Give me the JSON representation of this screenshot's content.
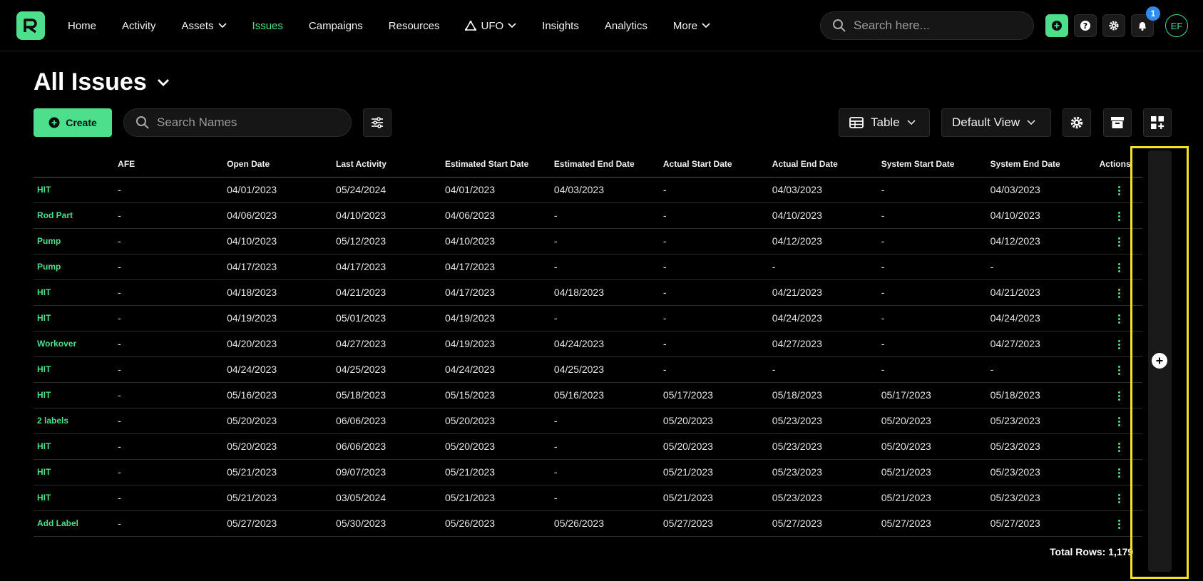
{
  "nav": {
    "items": [
      {
        "label": "Home",
        "name": "nav-home",
        "active": false,
        "dropdown": false,
        "icon": ""
      },
      {
        "label": "Activity",
        "name": "nav-activity",
        "active": false,
        "dropdown": false,
        "icon": ""
      },
      {
        "label": "Assets",
        "name": "nav-assets",
        "active": false,
        "dropdown": true,
        "icon": ""
      },
      {
        "label": "Issues",
        "name": "nav-issues",
        "active": true,
        "dropdown": false,
        "icon": ""
      },
      {
        "label": "Campaigns",
        "name": "nav-campaigns",
        "active": false,
        "dropdown": false,
        "icon": ""
      },
      {
        "label": "Resources",
        "name": "nav-resources",
        "active": false,
        "dropdown": false,
        "icon": ""
      },
      {
        "label": "UFO",
        "name": "nav-ufo",
        "active": false,
        "dropdown": true,
        "icon": "triangle-nodes-icon"
      },
      {
        "label": "Insights",
        "name": "nav-insights",
        "active": false,
        "dropdown": false,
        "icon": ""
      },
      {
        "label": "Analytics",
        "name": "nav-analytics",
        "active": false,
        "dropdown": false,
        "icon": ""
      },
      {
        "label": "More",
        "name": "nav-more",
        "active": false,
        "dropdown": true,
        "icon": ""
      }
    ],
    "search_placeholder": "Search here...",
    "notification_count": "1",
    "avatar_initials": "EF"
  },
  "page": {
    "title": "All Issues",
    "create_label": "Create",
    "search_placeholder": "Search Names",
    "view_mode": "Table",
    "saved_view": "Default View"
  },
  "colors": {
    "accent": "#4ddf8b",
    "highlight": "#f5e12a",
    "badge": "#2f8cf0"
  },
  "table": {
    "columns": [
      "",
      "AFE",
      "Open Date",
      "Last Activity",
      "Estimated Start Date",
      "Estimated End Date",
      "Actual Start Date",
      "Actual End Date",
      "System Start Date",
      "System End Date",
      "Actions"
    ],
    "rows": [
      [
        "HIT",
        "-",
        "04/01/2023",
        "05/24/2024",
        "04/01/2023",
        "04/03/2023",
        "-",
        "04/03/2023",
        "-",
        "04/03/2023"
      ],
      [
        "Rod Part",
        "-",
        "04/06/2023",
        "04/10/2023",
        "04/06/2023",
        "-",
        "-",
        "04/10/2023",
        "-",
        "04/10/2023"
      ],
      [
        "Pump",
        "-",
        "04/10/2023",
        "05/12/2023",
        "04/10/2023",
        "-",
        "-",
        "04/12/2023",
        "-",
        "04/12/2023"
      ],
      [
        "Pump",
        "-",
        "04/17/2023",
        "04/17/2023",
        "04/17/2023",
        "-",
        "-",
        "-",
        "-",
        "-"
      ],
      [
        "HIT",
        "-",
        "04/18/2023",
        "04/21/2023",
        "04/17/2023",
        "04/18/2023",
        "-",
        "04/21/2023",
        "-",
        "04/21/2023"
      ],
      [
        "HIT",
        "-",
        "04/19/2023",
        "05/01/2023",
        "04/19/2023",
        "-",
        "-",
        "04/24/2023",
        "-",
        "04/24/2023"
      ],
      [
        "Workover",
        "-",
        "04/20/2023",
        "04/27/2023",
        "04/19/2023",
        "04/24/2023",
        "-",
        "04/27/2023",
        "-",
        "04/27/2023"
      ],
      [
        "HIT",
        "-",
        "04/24/2023",
        "04/25/2023",
        "04/24/2023",
        "04/25/2023",
        "-",
        "-",
        "-",
        "-"
      ],
      [
        "HIT",
        "-",
        "05/16/2023",
        "05/18/2023",
        "05/15/2023",
        "05/16/2023",
        "05/17/2023",
        "05/18/2023",
        "05/17/2023",
        "05/18/2023"
      ],
      [
        "2 labels",
        "-",
        "05/20/2023",
        "06/06/2023",
        "05/20/2023",
        "-",
        "05/20/2023",
        "05/23/2023",
        "05/20/2023",
        "05/23/2023"
      ],
      [
        "HIT",
        "-",
        "05/20/2023",
        "06/06/2023",
        "05/20/2023",
        "-",
        "05/20/2023",
        "05/23/2023",
        "05/20/2023",
        "05/23/2023"
      ],
      [
        "HIT",
        "-",
        "05/21/2023",
        "09/07/2023",
        "05/21/2023",
        "-",
        "05/21/2023",
        "05/23/2023",
        "05/21/2023",
        "05/23/2023"
      ],
      [
        "HIT",
        "-",
        "05/21/2023",
        "03/05/2024",
        "05/21/2023",
        "-",
        "05/21/2023",
        "05/23/2023",
        "05/21/2023",
        "05/23/2023"
      ],
      [
        "Add Label",
        "-",
        "05/27/2023",
        "05/30/2023",
        "05/26/2023",
        "05/26/2023",
        "05/27/2023",
        "05/27/2023",
        "05/27/2023",
        "05/27/2023"
      ]
    ],
    "total_rows_text": "Total Rows: 1,179"
  }
}
